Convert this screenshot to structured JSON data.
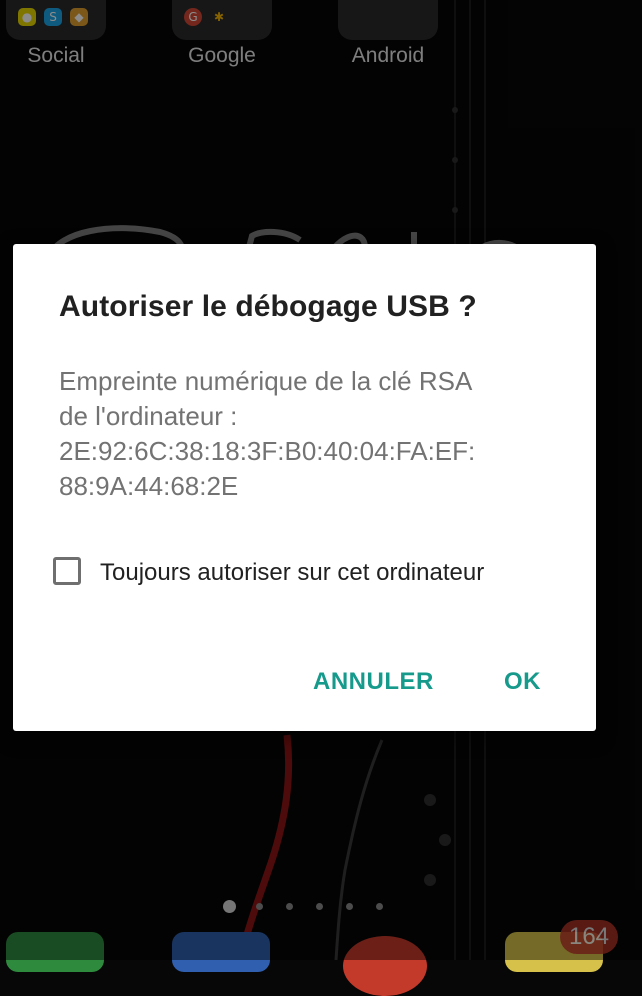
{
  "home": {
    "folders": [
      {
        "label": "Social"
      },
      {
        "label": "Google"
      },
      {
        "label": "Android"
      }
    ],
    "badge_count": "164"
  },
  "dialog": {
    "title": "Autoriser le débogage USB ?",
    "message_lines": [
      "Empreinte numérique de la clé RSA",
      "de l'ordinateur :",
      "2E:92:6C:38:18:3F:B0:40:04:FA:EF:",
      "88:9A:44:68:2E"
    ],
    "checkbox_label": "Toujours autoriser sur cet ordinateur",
    "checkbox_checked": false,
    "cancel_label": "ANNULER",
    "ok_label": "OK"
  },
  "colors": {
    "accent": "#169a8c",
    "badge": "#c0392b",
    "dialog_bg": "#ffffff",
    "background": "#070707"
  }
}
